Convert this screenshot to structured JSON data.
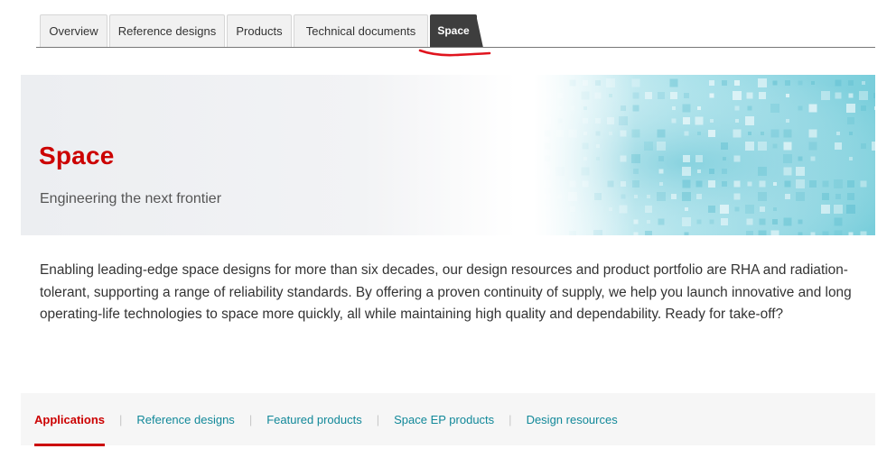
{
  "tabs": [
    {
      "label": "Overview",
      "active": false
    },
    {
      "label": "Reference designs",
      "active": false
    },
    {
      "label": "Products",
      "active": false
    },
    {
      "label": "Technical documents",
      "active": false
    },
    {
      "label": "Space",
      "active": true
    }
  ],
  "hero": {
    "title": "Space",
    "subtitle": "Engineering the next frontier"
  },
  "intro": {
    "text": "Enabling leading-edge space designs for more than six decades, our design resources and product portfolio are RHA and radiation-tolerant, supporting a range of reliability standards. By offering a proven continuity of supply, we help you launch innovative and long operating-life technologies to space more quickly, all while maintaining high quality and dependability. Ready for take-off?"
  },
  "section_nav": {
    "items": [
      {
        "label": "Applications",
        "active": true
      },
      {
        "label": "Reference designs",
        "active": false
      },
      {
        "label": "Featured products",
        "active": false
      },
      {
        "label": "Space EP products",
        "active": false
      },
      {
        "label": "Design resources",
        "active": false
      }
    ],
    "separator": "|"
  },
  "colors": {
    "brand_red": "#cc0000",
    "link_teal": "#118899",
    "active_tab": "#3e3e3e",
    "hero_accent": "#7fd3e0"
  }
}
